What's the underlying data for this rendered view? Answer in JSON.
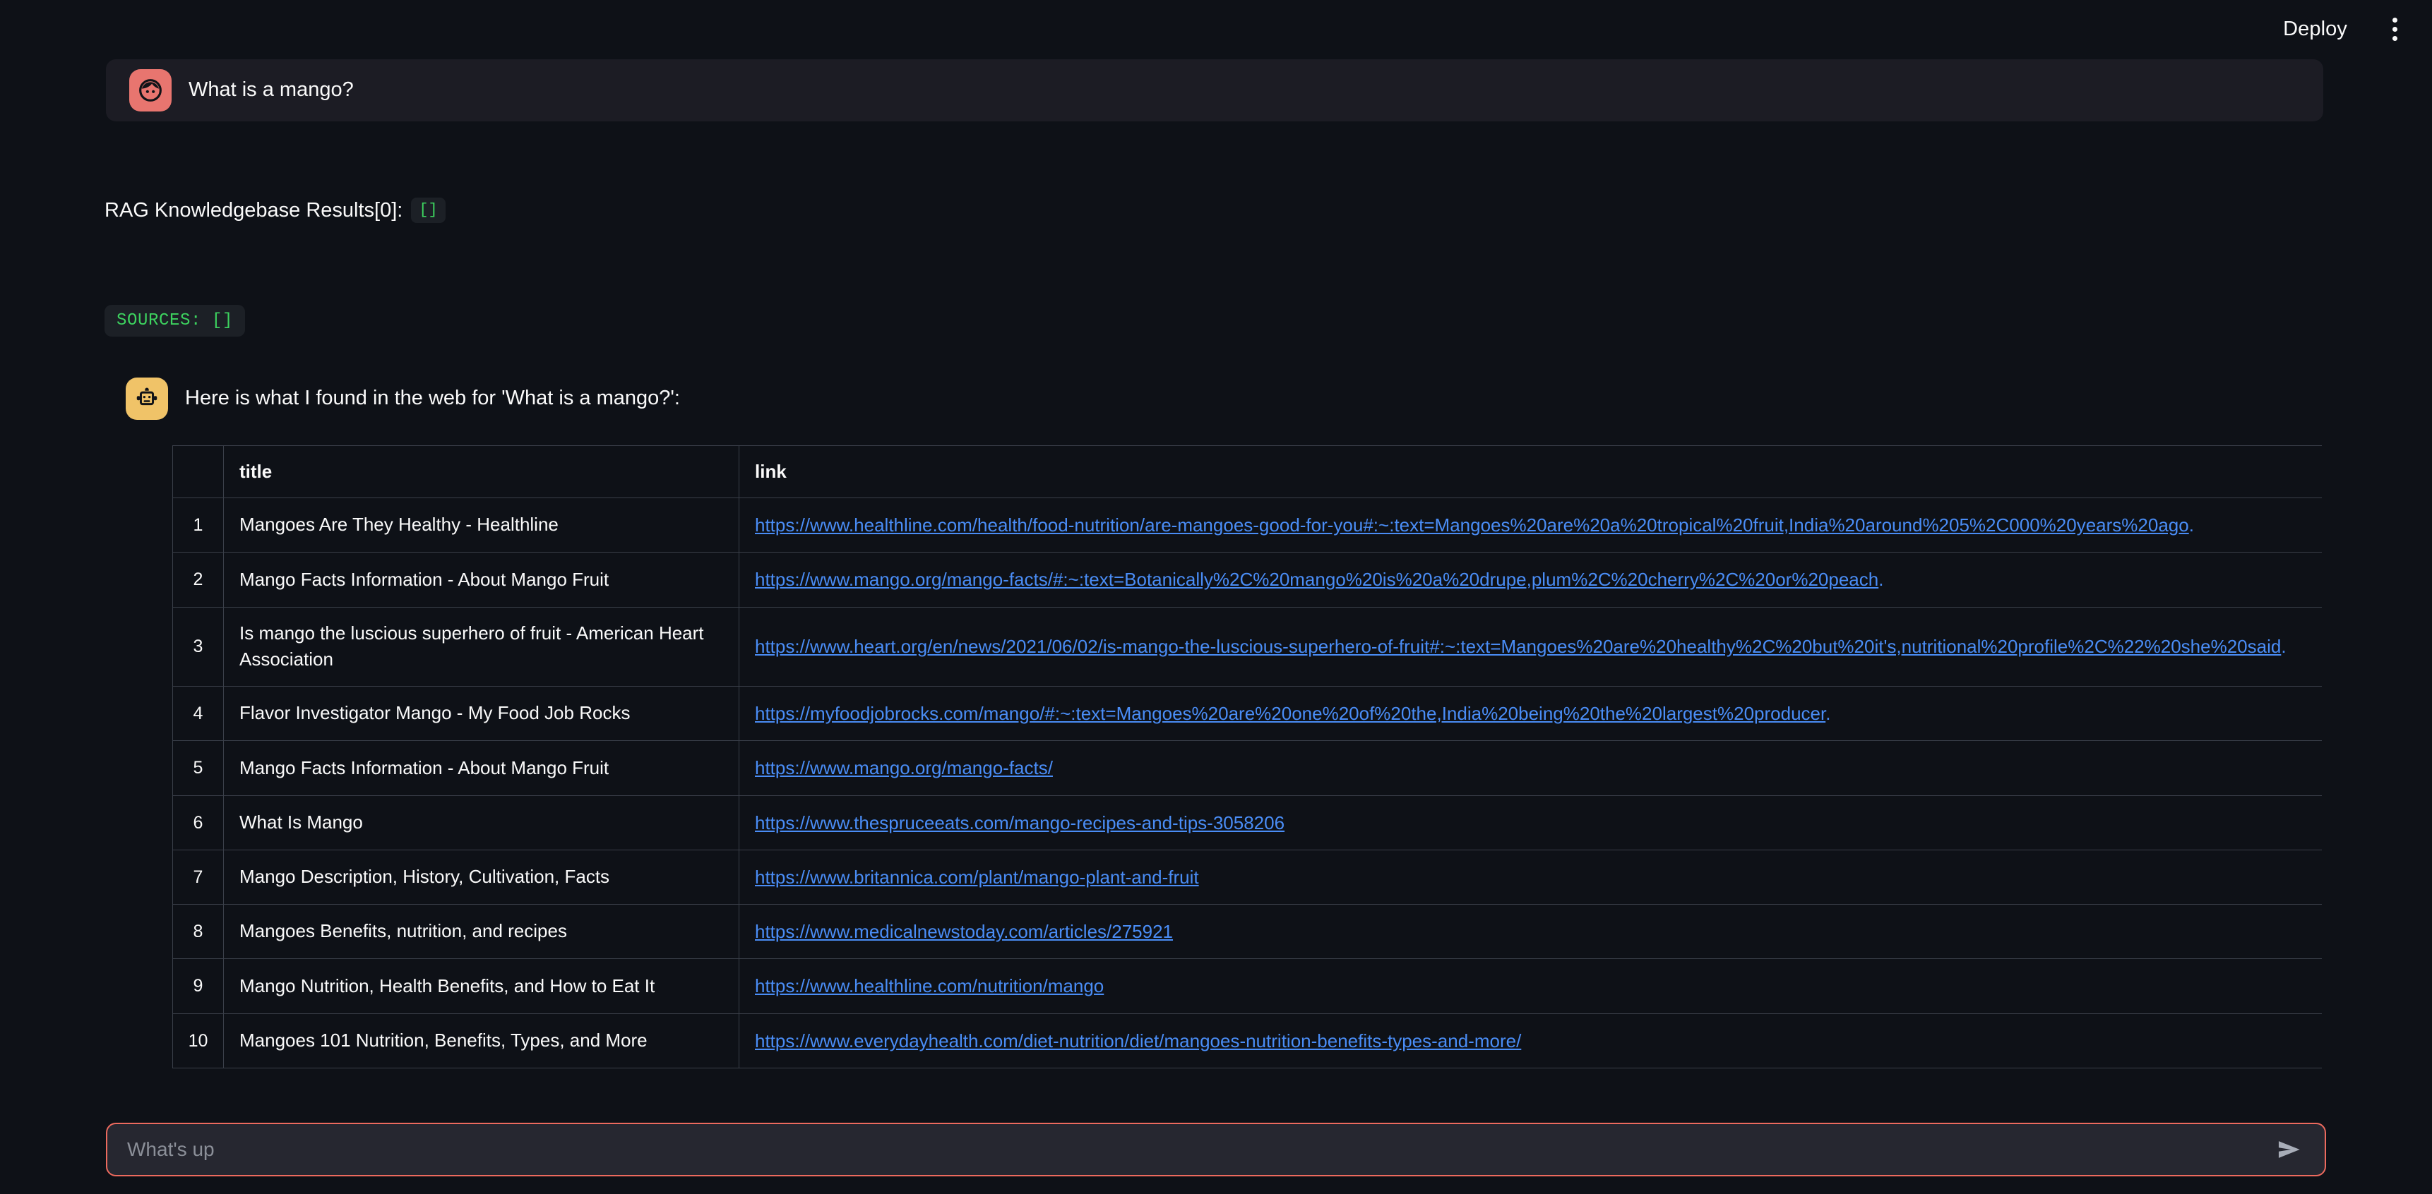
{
  "topbar": {
    "deploy_label": "Deploy",
    "menu_icon": "kebab-menu-icon"
  },
  "colors": {
    "page_bg": "#0e1117",
    "bubble_bg": "#1c1c24",
    "user_avatar_bg": "#e8756f",
    "bot_avatar_bg": "#f0c368",
    "code_green": "#3dd35f",
    "link_blue": "#4a8df6",
    "accent_border": "#ec6a5e",
    "input_bg": "#262730",
    "table_border": "#3a3f49",
    "text_primary": "#fafafa",
    "placeholder": "#8b8f98"
  },
  "messages": {
    "user": {
      "avatar_icon": "user-face-icon",
      "text": "What is a mango?"
    },
    "rag": {
      "label": "RAG Knowledgebase Results[0]:",
      "value": "[]"
    },
    "sources": {
      "text": "SOURCES: []"
    },
    "bot": {
      "avatar_icon": "robot-icon",
      "text": "Here is what I found in the web for 'What is a mango?':"
    }
  },
  "table": {
    "columns": [
      "",
      "title",
      "link"
    ],
    "rows": [
      {
        "index": "1",
        "title": "Mangoes Are They Healthy - Healthline",
        "link": "https://www.healthline.com/health/food-nutrition/are-mangoes-good-for-you#:~:text=Mangoes%20are%20a%20tropical%20fruit,India%20around%205%2C000%20years%20ago",
        "trailing": "."
      },
      {
        "index": "2",
        "title": "Mango Facts Information - About Mango Fruit",
        "link": "https://www.mango.org/mango-facts/#:~:text=Botanically%2C%20mango%20is%20a%20drupe,plum%2C%20cherry%2C%20or%20peach",
        "trailing": "."
      },
      {
        "index": "3",
        "title": "Is mango the luscious superhero of fruit - American Heart Association",
        "link": "https://www.heart.org/en/news/2021/06/02/is-mango-the-luscious-superhero-of-fruit#:~:text=Mangoes%20are%20healthy%2C%20but%20it's,nutritional%20profile%2C%22%20she%20said",
        "trailing": "."
      },
      {
        "index": "4",
        "title": "Flavor Investigator Mango - My Food Job Rocks",
        "link": "https://myfoodjobrocks.com/mango/#:~:text=Mangoes%20are%20one%20of%20the,India%20being%20the%20largest%20producer",
        "trailing": "."
      },
      {
        "index": "5",
        "title": "Mango Facts Information - About Mango Fruit",
        "link": "https://www.mango.org/mango-facts/",
        "trailing": ""
      },
      {
        "index": "6",
        "title": "What Is Mango",
        "link": "https://www.thespruceeats.com/mango-recipes-and-tips-3058206",
        "trailing": ""
      },
      {
        "index": "7",
        "title": "Mango Description, History, Cultivation, Facts",
        "link": "https://www.britannica.com/plant/mango-plant-and-fruit",
        "trailing": ""
      },
      {
        "index": "8",
        "title": "Mangoes Benefits, nutrition, and recipes",
        "link": "https://www.medicalnewstoday.com/articles/275921",
        "trailing": ""
      },
      {
        "index": "9",
        "title": "Mango Nutrition, Health Benefits, and How to Eat It",
        "link": "https://www.healthline.com/nutrition/mango",
        "trailing": ""
      },
      {
        "index": "10",
        "title": "Mangoes 101 Nutrition, Benefits, Types, and More",
        "link": "https://www.everydayhealth.com/diet-nutrition/diet/mangoes-nutrition-benefits-types-and-more/",
        "trailing": ""
      }
    ]
  },
  "composer": {
    "placeholder": "What's up",
    "value": "",
    "send_icon": "send-paper-plane-icon"
  }
}
